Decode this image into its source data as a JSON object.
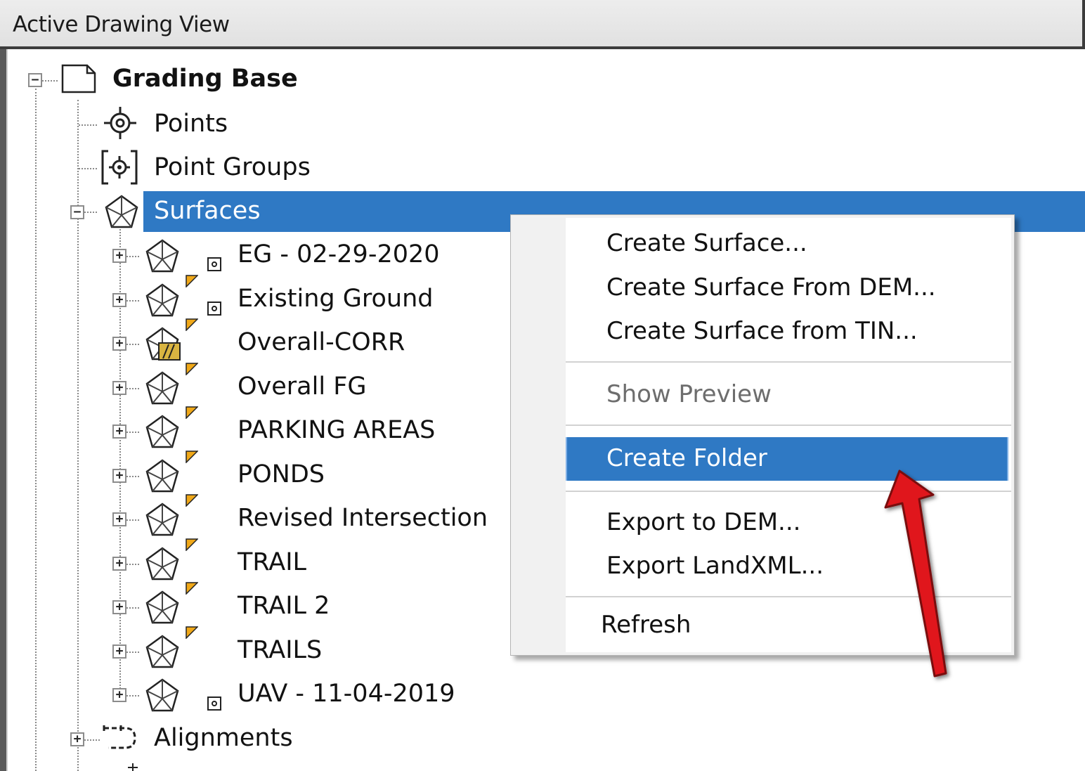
{
  "header": {
    "title": "Active Drawing View"
  },
  "tree": {
    "root": {
      "label": "Grading Base",
      "expander": "−"
    },
    "points": {
      "label": "Points"
    },
    "point_groups": {
      "label": "Point Groups"
    },
    "surfaces": {
      "label": "Surfaces",
      "expander": "−"
    },
    "surface_items": [
      {
        "label": "EG - 02-29-2020",
        "flag": false,
        "link": true,
        "icon": "surface-icon"
      },
      {
        "label": "Existing Ground",
        "flag": true,
        "link": true,
        "icon": "surface-icon"
      },
      {
        "label": "Overall-CORR",
        "flag": true,
        "link": false,
        "icon": "corridor-surface-icon"
      },
      {
        "label": "Overall FG",
        "flag": true,
        "link": false,
        "icon": "surface-icon"
      },
      {
        "label": "PARKING AREAS",
        "flag": true,
        "link": false,
        "icon": "surface-icon"
      },
      {
        "label": "PONDS",
        "flag": true,
        "link": false,
        "icon": "surface-icon"
      },
      {
        "label": "Revised Intersection",
        "flag": true,
        "link": false,
        "icon": "surface-icon"
      },
      {
        "label": "TRAIL",
        "flag": true,
        "link": false,
        "icon": "surface-icon"
      },
      {
        "label": "TRAIL 2",
        "flag": true,
        "link": false,
        "icon": "surface-icon"
      },
      {
        "label": "TRAILS",
        "flag": true,
        "link": false,
        "icon": "surface-icon"
      },
      {
        "label": "UAV - 11-04-2019",
        "flag": false,
        "link": true,
        "icon": "surface-icon"
      }
    ],
    "alignments": {
      "label": "Alignments",
      "expander": "+"
    },
    "expander_plus": "+"
  },
  "context_menu": {
    "items": [
      {
        "label": "Create Surface...",
        "enabled": true
      },
      {
        "label": "Create Surface From DEM...",
        "enabled": true
      },
      {
        "label": "Create Surface from TIN...",
        "enabled": true
      },
      {
        "label": "Show Preview",
        "enabled": false
      },
      {
        "label": "Create Folder",
        "enabled": true,
        "highlighted": true
      },
      {
        "label": "Export to DEM...",
        "enabled": true
      },
      {
        "label": "Export LandXML...",
        "enabled": true
      },
      {
        "label": "Refresh",
        "enabled": true
      }
    ]
  },
  "colors": {
    "selection": "#2f79c4",
    "flag": "#f0a818",
    "arrow": "#e0141e"
  }
}
